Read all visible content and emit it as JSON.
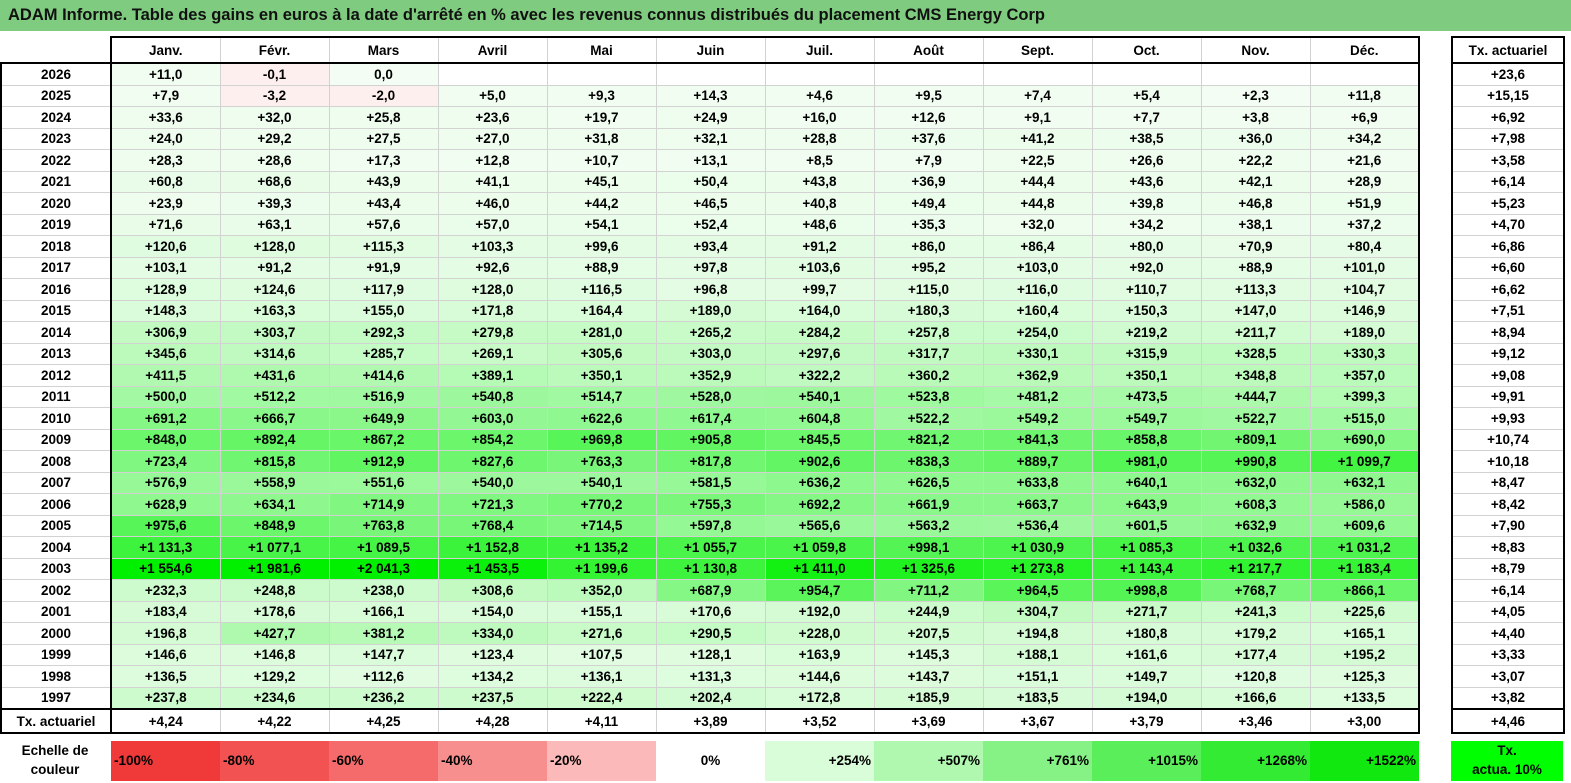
{
  "title": "ADAM Informe. Table des gains en euros à la date d'arrêté en % avec les revenus connus distribués du placement CMS Energy Corp",
  "chart_data": {
    "type": "table",
    "columns": [
      "Janv.",
      "Févr.",
      "Mars",
      "Avril",
      "Mai",
      "Juin",
      "Juil.",
      "Août",
      "Sept.",
      "Oct.",
      "Nov.",
      "Déc."
    ],
    "side_header": "Tx. actuariel",
    "rows": [
      {
        "year": "2026",
        "values": [
          "+11,0",
          "-0,1",
          "0,0",
          "",
          "",
          "",
          "",
          "",
          "",
          "",
          "",
          ""
        ],
        "rate": "+23,6"
      },
      {
        "year": "2025",
        "values": [
          "+7,9",
          "-3,2",
          "-2,0",
          "+5,0",
          "+9,3",
          "+14,3",
          "+4,6",
          "+9,5",
          "+7,4",
          "+5,4",
          "+2,3",
          "+11,8"
        ],
        "rate": "+15,15"
      },
      {
        "year": "2024",
        "values": [
          "+33,6",
          "+32,0",
          "+25,8",
          "+23,6",
          "+19,7",
          "+24,9",
          "+16,0",
          "+12,6",
          "+9,1",
          "+7,7",
          "+3,8",
          "+6,9"
        ],
        "rate": "+6,92"
      },
      {
        "year": "2023",
        "values": [
          "+24,0",
          "+29,2",
          "+27,5",
          "+27,0",
          "+31,8",
          "+32,1",
          "+28,8",
          "+37,6",
          "+41,2",
          "+38,5",
          "+36,0",
          "+34,2"
        ],
        "rate": "+7,98"
      },
      {
        "year": "2022",
        "values": [
          "+28,3",
          "+28,6",
          "+17,3",
          "+12,8",
          "+10,7",
          "+13,1",
          "+8,5",
          "+7,9",
          "+22,5",
          "+26,6",
          "+22,2",
          "+21,6"
        ],
        "rate": "+3,58"
      },
      {
        "year": "2021",
        "values": [
          "+60,8",
          "+68,6",
          "+43,9",
          "+41,1",
          "+45,1",
          "+50,4",
          "+43,8",
          "+36,9",
          "+44,4",
          "+43,6",
          "+42,1",
          "+28,9"
        ],
        "rate": "+6,14"
      },
      {
        "year": "2020",
        "values": [
          "+23,9",
          "+39,3",
          "+43,4",
          "+46,0",
          "+44,2",
          "+46,5",
          "+40,8",
          "+49,4",
          "+44,8",
          "+39,8",
          "+46,8",
          "+51,9"
        ],
        "rate": "+5,23"
      },
      {
        "year": "2019",
        "values": [
          "+71,6",
          "+63,1",
          "+57,6",
          "+57,0",
          "+54,1",
          "+52,4",
          "+48,6",
          "+35,3",
          "+32,0",
          "+34,2",
          "+38,1",
          "+37,2"
        ],
        "rate": "+4,70"
      },
      {
        "year": "2018",
        "values": [
          "+120,6",
          "+128,0",
          "+115,3",
          "+103,3",
          "+99,6",
          "+93,4",
          "+91,2",
          "+86,0",
          "+86,4",
          "+80,0",
          "+70,9",
          "+80,4"
        ],
        "rate": "+6,86"
      },
      {
        "year": "2017",
        "values": [
          "+103,1",
          "+91,2",
          "+91,9",
          "+92,6",
          "+88,9",
          "+97,8",
          "+103,6",
          "+95,2",
          "+103,0",
          "+92,0",
          "+88,9",
          "+101,0"
        ],
        "rate": "+6,60"
      },
      {
        "year": "2016",
        "values": [
          "+128,9",
          "+124,6",
          "+117,9",
          "+128,0",
          "+116,5",
          "+96,8",
          "+99,7",
          "+115,0",
          "+116,0",
          "+110,7",
          "+113,3",
          "+104,7"
        ],
        "rate": "+6,62"
      },
      {
        "year": "2015",
        "values": [
          "+148,3",
          "+163,3",
          "+155,0",
          "+171,8",
          "+164,4",
          "+189,0",
          "+164,0",
          "+180,3",
          "+160,4",
          "+150,3",
          "+147,0",
          "+146,9"
        ],
        "rate": "+7,51"
      },
      {
        "year": "2014",
        "values": [
          "+306,9",
          "+303,7",
          "+292,3",
          "+279,8",
          "+281,0",
          "+265,2",
          "+284,2",
          "+257,8",
          "+254,0",
          "+219,2",
          "+211,7",
          "+189,0"
        ],
        "rate": "+8,94"
      },
      {
        "year": "2013",
        "values": [
          "+345,6",
          "+314,6",
          "+285,7",
          "+269,1",
          "+305,6",
          "+303,0",
          "+297,6",
          "+317,7",
          "+330,1",
          "+315,9",
          "+328,5",
          "+330,3"
        ],
        "rate": "+9,12"
      },
      {
        "year": "2012",
        "values": [
          "+411,5",
          "+431,6",
          "+414,6",
          "+389,1",
          "+350,1",
          "+352,9",
          "+322,2",
          "+360,2",
          "+362,9",
          "+350,1",
          "+348,8",
          "+357,0"
        ],
        "rate": "+9,08"
      },
      {
        "year": "2011",
        "values": [
          "+500,0",
          "+512,2",
          "+516,9",
          "+540,8",
          "+514,7",
          "+528,0",
          "+540,1",
          "+523,8",
          "+481,2",
          "+473,5",
          "+444,7",
          "+399,3"
        ],
        "rate": "+9,91"
      },
      {
        "year": "2010",
        "values": [
          "+691,2",
          "+666,7",
          "+649,9",
          "+603,0",
          "+622,6",
          "+617,4",
          "+604,8",
          "+522,2",
          "+549,2",
          "+549,7",
          "+522,7",
          "+515,0"
        ],
        "rate": "+9,93"
      },
      {
        "year": "2009",
        "values": [
          "+848,0",
          "+892,4",
          "+867,2",
          "+854,2",
          "+969,8",
          "+905,8",
          "+845,5",
          "+821,2",
          "+841,3",
          "+858,8",
          "+809,1",
          "+690,0"
        ],
        "rate": "+10,74"
      },
      {
        "year": "2008",
        "values": [
          "+723,4",
          "+815,8",
          "+912,9",
          "+827,6",
          "+763,3",
          "+817,8",
          "+902,6",
          "+838,3",
          "+889,7",
          "+981,0",
          "+990,8",
          "+1 099,7"
        ],
        "rate": "+10,18"
      },
      {
        "year": "2007",
        "values": [
          "+576,9",
          "+558,9",
          "+551,6",
          "+540,0",
          "+540,1",
          "+581,5",
          "+636,2",
          "+626,5",
          "+633,8",
          "+640,1",
          "+632,0",
          "+632,1"
        ],
        "rate": "+8,47"
      },
      {
        "year": "2006",
        "values": [
          "+628,9",
          "+634,1",
          "+714,9",
          "+721,3",
          "+770,2",
          "+755,3",
          "+692,2",
          "+661,9",
          "+663,7",
          "+643,9",
          "+608,3",
          "+586,0"
        ],
        "rate": "+8,42"
      },
      {
        "year": "2005",
        "values": [
          "+975,6",
          "+848,9",
          "+763,8",
          "+768,4",
          "+714,5",
          "+597,8",
          "+565,6",
          "+563,2",
          "+536,4",
          "+601,5",
          "+632,9",
          "+609,6"
        ],
        "rate": "+7,90"
      },
      {
        "year": "2004",
        "values": [
          "+1 131,3",
          "+1 077,1",
          "+1 089,5",
          "+1 152,8",
          "+1 135,2",
          "+1 055,7",
          "+1 059,8",
          "+998,1",
          "+1 030,9",
          "+1 085,3",
          "+1 032,6",
          "+1 031,2"
        ],
        "rate": "+8,83"
      },
      {
        "year": "2003",
        "values": [
          "+1 554,6",
          "+1 981,6",
          "+2 041,3",
          "+1 453,5",
          "+1 199,6",
          "+1 130,8",
          "+1 411,0",
          "+1 325,6",
          "+1 273,8",
          "+1 143,4",
          "+1 217,7",
          "+1 183,4"
        ],
        "rate": "+8,79"
      },
      {
        "year": "2002",
        "values": [
          "+232,3",
          "+248,8",
          "+238,0",
          "+308,6",
          "+352,0",
          "+687,9",
          "+954,7",
          "+711,2",
          "+964,5",
          "+998,8",
          "+768,7",
          "+866,1"
        ],
        "rate": "+6,14"
      },
      {
        "year": "2001",
        "values": [
          "+183,4",
          "+178,6",
          "+166,1",
          "+154,0",
          "+155,1",
          "+170,6",
          "+192,0",
          "+244,9",
          "+304,7",
          "+271,7",
          "+241,3",
          "+225,6"
        ],
        "rate": "+4,05"
      },
      {
        "year": "2000",
        "values": [
          "+196,8",
          "+427,7",
          "+381,2",
          "+334,0",
          "+271,6",
          "+290,5",
          "+228,0",
          "+207,5",
          "+194,8",
          "+180,8",
          "+179,2",
          "+165,1"
        ],
        "rate": "+4,40"
      },
      {
        "year": "1999",
        "values": [
          "+146,6",
          "+146,8",
          "+147,7",
          "+123,4",
          "+107,5",
          "+128,1",
          "+163,9",
          "+145,3",
          "+188,1",
          "+161,6",
          "+177,4",
          "+195,2"
        ],
        "rate": "+3,33"
      },
      {
        "year": "1998",
        "values": [
          "+136,5",
          "+129,2",
          "+112,6",
          "+134,2",
          "+136,1",
          "+131,3",
          "+144,6",
          "+143,7",
          "+151,1",
          "+149,7",
          "+120,8",
          "+125,3"
        ],
        "rate": "+3,07"
      },
      {
        "year": "1997",
        "values": [
          "+237,8",
          "+234,6",
          "+236,2",
          "+237,5",
          "+222,4",
          "+202,4",
          "+172,8",
          "+185,9",
          "+183,5",
          "+194,0",
          "+166,6",
          "+133,5"
        ],
        "rate": "+3,82"
      }
    ],
    "footer": {
      "label": "Tx. actuariel",
      "values": [
        "+4,24",
        "+4,22",
        "+4,25",
        "+4,28",
        "+4,11",
        "+3,89",
        "+3,52",
        "+3,69",
        "+3,67",
        "+3,79",
        "+3,46",
        "+3,00"
      ],
      "rate": "+4,46"
    }
  },
  "scale": {
    "label_line1": "Echelle de",
    "label_line2": "couleur",
    "items": [
      {
        "label": "-100%",
        "color": "#f03a3a",
        "align": "left"
      },
      {
        "label": "-80%",
        "color": "#f35252",
        "align": "left"
      },
      {
        "label": "-60%",
        "color": "#f56a6a",
        "align": "left"
      },
      {
        "label": "-40%",
        "color": "#f88f8f",
        "align": "left"
      },
      {
        "label": "-20%",
        "color": "#fbb9b9",
        "align": "left"
      },
      {
        "label": "0%",
        "color": "#ffffff",
        "align": "center"
      },
      {
        "label": "+254%",
        "color": "#d9fcd9",
        "align": "right"
      },
      {
        "label": "+507%",
        "color": "#b0f7b0",
        "align": "right"
      },
      {
        "label": "+761%",
        "color": "#86f286",
        "align": "right"
      },
      {
        "label": "+1015%",
        "color": "#5aee5a",
        "align": "right"
      },
      {
        "label": "+1268%",
        "color": "#33eb33",
        "align": "right"
      },
      {
        "label": "+1522%",
        "color": "#10e810",
        "align": "right"
      }
    ],
    "actua_line1": "Tx.",
    "actua_line2": "actua. 10%",
    "actua_color": "#00ff00"
  }
}
